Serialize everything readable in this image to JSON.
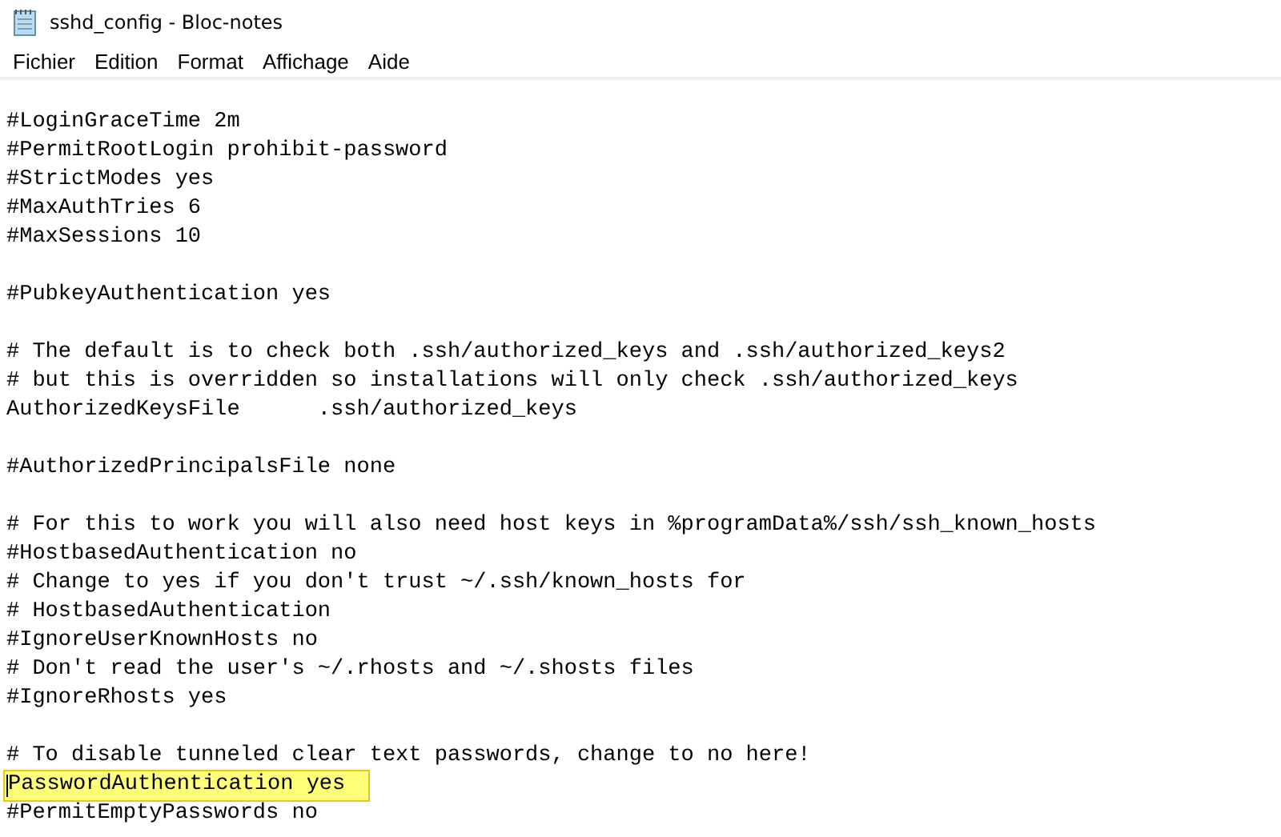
{
  "window": {
    "title": "sshd_config - Bloc-notes"
  },
  "menu": [
    "Fichier",
    "Edition",
    "Format",
    "Affichage",
    "Aide"
  ],
  "editor": {
    "blocks": [
      [
        {
          "text": "#LoginGraceTime 2m",
          "highlighted": false
        },
        {
          "text": "#PermitRootLogin prohibit-password",
          "highlighted": false
        },
        {
          "text": "#StrictModes yes",
          "highlighted": false
        },
        {
          "text": "#MaxAuthTries 6",
          "highlighted": false
        },
        {
          "text": "#MaxSessions 10",
          "highlighted": false
        }
      ],
      [
        {
          "text": "#PubkeyAuthentication yes",
          "highlighted": false
        }
      ],
      [
        {
          "text": "# The default is to check both .ssh/authorized_keys and .ssh/authorized_keys2",
          "highlighted": false
        },
        {
          "text": "# but this is overridden so installations will only check .ssh/authorized_keys",
          "highlighted": false
        },
        {
          "text": "AuthorizedKeysFile      .ssh/authorized_keys",
          "highlighted": false
        }
      ],
      [
        {
          "text": "#AuthorizedPrincipalsFile none",
          "highlighted": false
        }
      ],
      [
        {
          "text": "# For this to work you will also need host keys in %programData%/ssh/ssh_known_hosts",
          "highlighted": false
        },
        {
          "text": "#HostbasedAuthentication no",
          "highlighted": false
        },
        {
          "text": "# Change to yes if you don't trust ~/.ssh/known_hosts for",
          "highlighted": false
        },
        {
          "text": "# HostbasedAuthentication",
          "highlighted": false
        },
        {
          "text": "#IgnoreUserKnownHosts no",
          "highlighted": false
        },
        {
          "text": "# Don't read the user's ~/.rhosts and ~/.shosts files",
          "highlighted": false
        },
        {
          "text": "#IgnoreRhosts yes",
          "highlighted": false
        }
      ],
      [
        {
          "text": "# To disable tunneled clear text passwords, change to no here!",
          "highlighted": false
        },
        {
          "text": "PasswordAuthentication yes",
          "highlighted": true
        },
        {
          "text": "#PermitEmptyPasswords no",
          "highlighted": false
        }
      ]
    ]
  }
}
